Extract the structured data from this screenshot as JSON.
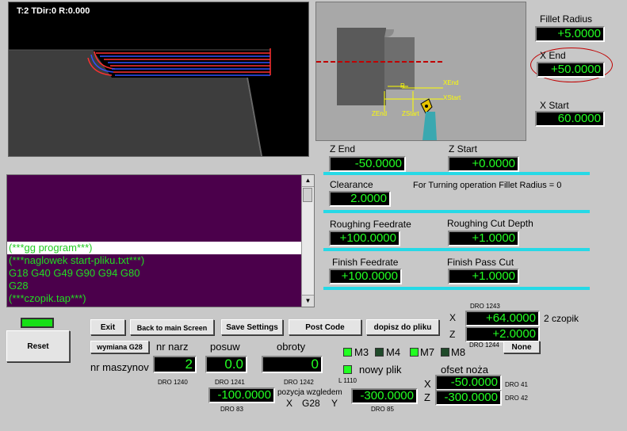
{
  "viewport": {
    "status": "T:2 TDir:0 R:0.000"
  },
  "diagram": {
    "labels": {
      "r": "R",
      "xend": "XEnd",
      "xstart": "XStart",
      "zend": "ZEnd",
      "zstart": "ZStart"
    }
  },
  "fields": {
    "fillet_radius": {
      "label": "Fillet Radius",
      "value": "+5.0000"
    },
    "x_end": {
      "label": "X End",
      "value": "+50.0000"
    },
    "x_start": {
      "label": "X Start",
      "value": "60.0000"
    },
    "z_end": {
      "label": "Z End",
      "value": "-50.0000"
    },
    "z_start": {
      "label": "Z Start",
      "value": "+0.0000"
    },
    "clearance": {
      "label": "Clearance",
      "value": "2.0000"
    },
    "note": "For Turning operation Fillet Radius = 0",
    "roughing_feedrate": {
      "label": "Roughing Feedrate",
      "value": "+100.0000"
    },
    "roughing_cut_depth": {
      "label": "Roughing Cut Depth",
      "value": "+1.0000"
    },
    "finish_feedrate": {
      "label": "Finish Feedrate",
      "value": "+100.0000"
    },
    "finish_pass_cut": {
      "label": "Finish Pass Cut",
      "value": "+1.0000"
    }
  },
  "code": {
    "highlighted": "(***gg program***)",
    "lines": [
      "(***naglowek start-pliku.txt***)",
      "G18 G40 G49 G90 G94 G80",
      "G28",
      "(***czopik.tap***)"
    ]
  },
  "buttons": {
    "exit": "Exit",
    "back": "Back to main Screen",
    "save": "Save Settings",
    "post": "Post Code",
    "dopisz": "dopisz do pliku",
    "reset": "Reset",
    "wymiana": "wymiana G28",
    "none": "None"
  },
  "dro_1243": {
    "caption": "DRO 1243",
    "axis": "X",
    "value": "+64.0000",
    "name": "2 czopik"
  },
  "dro_1244": {
    "caption": "DRO 1244",
    "axis": "Z",
    "value": "+2.0000"
  },
  "tool": {
    "nr_narz": {
      "label": "nr narz",
      "value": "2",
      "caption": "DRO 1240"
    },
    "posuw": {
      "label": "posuw",
      "value": "0.0",
      "caption": "DRO 1241"
    },
    "obroty": {
      "label": "obroty",
      "value": "0",
      "caption": "DRO 1242"
    },
    "nr_maszynov": "nr maszynov"
  },
  "leds": [
    {
      "label": "M3",
      "on": true
    },
    {
      "label": "M4",
      "on": false
    },
    {
      "label": "M7",
      "on": true
    },
    {
      "label": "M8",
      "on": false
    }
  ],
  "nowy_plik": {
    "label": "nowy plik",
    "caption": "L 1110"
  },
  "offset": {
    "title": "ofset noża",
    "x": {
      "axis": "X",
      "value": "-50.0000",
      "caption": "DRO 41"
    },
    "z": {
      "axis": "Z",
      "value": "-300.0000",
      "caption": "DRO 42"
    }
  },
  "g28": {
    "title": "pozycja wzgledem",
    "x_axis": "X",
    "mid": "G28",
    "y_axis": "Y",
    "x": {
      "value": "-100.0000",
      "caption": "DRO 83"
    },
    "y": {
      "value": "-300.0000",
      "caption": "DRO 85"
    }
  }
}
